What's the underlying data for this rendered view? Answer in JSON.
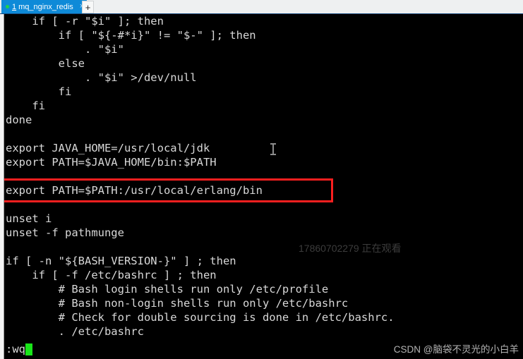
{
  "window": {
    "tab": {
      "index": "1",
      "title": "mq_nginx_redis",
      "close_label": "×",
      "add_label": "+",
      "active_color": "#0e8ad8",
      "status_dot_color": "#1fd14b"
    }
  },
  "terminal": {
    "background": "#000000",
    "foreground": "#d8d8d8",
    "lines": [
      "    if [ -r \"$i\" ]; then",
      "        if [ \"${-#*i}\" != \"$-\" ]; then",
      "            . \"$i\"",
      "        else",
      "            . \"$i\" >/dev/null",
      "        fi",
      "    fi",
      "done",
      "",
      "export JAVA_HOME=/usr/local/jdk",
      "export PATH=$JAVA_HOME/bin:$PATH",
      "",
      "export PATH=$PATH:/usr/local/erlang/bin",
      "",
      "unset i",
      "unset -f pathmunge",
      "",
      "if [ -n \"${BASH_VERSION-}\" ] ; then",
      "    if [ -f /etc/bashrc ] ; then",
      "        # Bash login shells run only /etc/profile",
      "        # Bash non-login shells run only /etc/bashrc",
      "        # Check for double sourcing is done in /etc/bashrc.",
      "        . /etc/bashrc"
    ],
    "status": {
      "command": ":wq",
      "cursor_color": "#19e519"
    },
    "highlight": {
      "color": "#fb1f1f",
      "target_line": "export PATH=$PATH:/usr/local/erlang/bin"
    }
  },
  "watermarks": {
    "viewer": "17860702279 正在观看",
    "author": "CSDN @脑袋不灵光的小白羊"
  }
}
